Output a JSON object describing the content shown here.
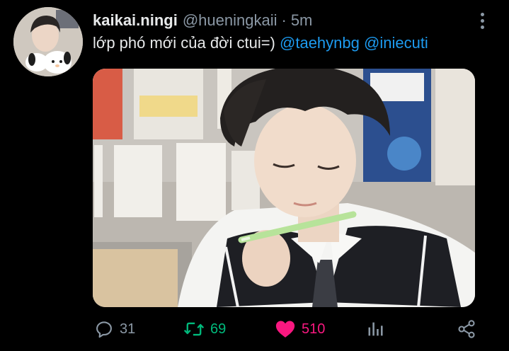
{
  "tweet": {
    "display_name": "kaikai.ningi",
    "handle": "@hueningkaii",
    "separator": "·",
    "time": "5m",
    "text": "lớp phó mới của đời ctui=)",
    "mentions": [
      "@taehynbg",
      "@iniecuti"
    ],
    "avatar_icon": "profile-avatar",
    "media_alt": "photo"
  },
  "actions": {
    "reply": {
      "icon": "reply-icon",
      "count": "31"
    },
    "retweet": {
      "icon": "retweet-icon",
      "count": "69",
      "active": true,
      "color": "#00ba7c"
    },
    "like": {
      "icon": "heart-icon",
      "count": "510",
      "active": true,
      "color": "#f91880"
    },
    "stats": {
      "icon": "stats-icon"
    },
    "share": {
      "icon": "share-icon"
    }
  },
  "colors": {
    "background": "#000000",
    "primary_text": "#e7e9ea",
    "secondary_text": "#8b98a5",
    "link": "#1d9bf0"
  }
}
